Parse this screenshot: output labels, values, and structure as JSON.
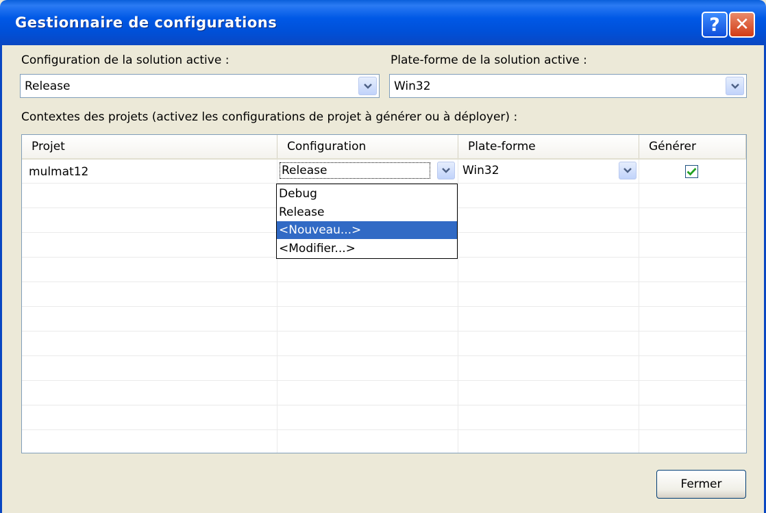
{
  "window": {
    "title": "Gestionnaire de configurations",
    "help_glyph": "?",
    "close_glyph": "✕"
  },
  "solution": {
    "config_label": "Configuration de la solution active :",
    "config_value": "Release",
    "platform_label": "Plate-forme de la solution active :",
    "platform_value": "Win32"
  },
  "contexts": {
    "label": "Contextes des projets (activez les configurations de projet à générer ou à déployer) :",
    "columns": [
      "Projet",
      "Configuration",
      "Plate-forme",
      "Générer"
    ],
    "rows": [
      {
        "project": "mulmat12",
        "configuration": "Release",
        "platform": "Win32",
        "build": true
      }
    ]
  },
  "config_dropdown": {
    "options": [
      "Debug",
      "Release",
      "<Nouveau...>",
      "<Modifier...>"
    ],
    "highlighted": "<Nouveau...>"
  },
  "footer": {
    "close_label": "Fermer"
  },
  "colors": {
    "titlebar": "#0058E6",
    "selection": "#316AC5",
    "dialog_bg": "#ECE9D8"
  }
}
